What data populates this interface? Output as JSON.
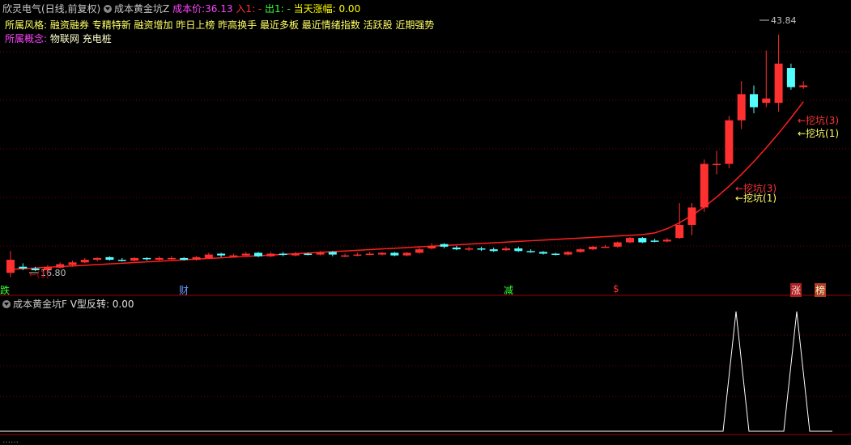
{
  "header": {
    "stock_name": "欣灵电气(日线,前复权)",
    "indicator_name": "成本黄金坑Z",
    "cost_label": "成本价:",
    "cost_value": "36.13",
    "in_label": "入1: -",
    "out_label": "出1: -",
    "change_label": "当天涨幅: 0.00"
  },
  "style": {
    "label": "所属风格:",
    "value": "融资融券 专精特新 融资增加 昨日上榜 昨高换手 最近多板 最近情绪指数 活跃股 近期强势"
  },
  "concept": {
    "label": "所属概念:",
    "value": "物联网 充电桩"
  },
  "price_labels": {
    "high": "43.84",
    "low": "16.80"
  },
  "annotations": {
    "dig3": "←挖坑(3)",
    "dig1": "←挖坑(1)",
    "low_overlay": "←(1)"
  },
  "bottom_markers": [
    "跌",
    "财",
    "减",
    "$",
    "涨",
    "榜"
  ],
  "sub_panel": {
    "title": "成本黄金坑F",
    "v_label": "V型反转: 0.00"
  },
  "footer": {
    "text": "……"
  },
  "colors": {
    "up": "#ff3030",
    "down": "#54ffff",
    "cost_line": "#ff1f1f",
    "grid": "#7a0000",
    "bg": "#000000"
  },
  "chart_data": {
    "type": "candlestick",
    "price_max_label": 43.84,
    "price_min_label": 16.8,
    "candles": [
      [
        16.5,
        18.0,
        19.0,
        16.0
      ],
      [
        17.2,
        17.0,
        17.6,
        16.8
      ],
      [
        17.0,
        16.8,
        17.2,
        16.7
      ],
      [
        16.8,
        17.2,
        17.4,
        16.6
      ],
      [
        17.1,
        17.5,
        17.7,
        17.0
      ],
      [
        17.4,
        17.7,
        17.9,
        17.2
      ],
      [
        17.7,
        18.0,
        18.2,
        17.6
      ],
      [
        18.0,
        18.2,
        18.3,
        17.8
      ],
      [
        18.3,
        18.0,
        18.4,
        17.9
      ],
      [
        18.0,
        17.9,
        18.2,
        17.8
      ],
      [
        17.9,
        18.2,
        18.3,
        17.8
      ],
      [
        18.2,
        18.1,
        18.3,
        17.9
      ],
      [
        18.0,
        18.2,
        18.4,
        17.9
      ],
      [
        18.1,
        18.2,
        18.4,
        18.0
      ],
      [
        18.2,
        18.0,
        18.3,
        17.9
      ],
      [
        18.0,
        18.3,
        18.4,
        17.9
      ],
      [
        18.2,
        18.6,
        18.8,
        18.1
      ],
      [
        18.7,
        18.5,
        18.8,
        18.3
      ],
      [
        18.5,
        18.5,
        18.7,
        18.3
      ],
      [
        18.5,
        18.7,
        18.9,
        18.4
      ],
      [
        18.8,
        18.4,
        18.9,
        18.3
      ],
      [
        18.4,
        18.7,
        18.9,
        18.3
      ],
      [
        18.7,
        18.6,
        18.9,
        18.4
      ],
      [
        18.5,
        18.7,
        18.9,
        18.4
      ],
      [
        18.7,
        18.6,
        18.8,
        18.5
      ],
      [
        18.6,
        18.8,
        19.0,
        18.5
      ],
      [
        18.9,
        18.6,
        19.0,
        18.4
      ],
      [
        18.5,
        18.5,
        18.7,
        18.3
      ],
      [
        18.6,
        18.6,
        18.8,
        18.4
      ],
      [
        18.6,
        18.7,
        18.9,
        18.5
      ],
      [
        18.6,
        18.8,
        18.9,
        18.5
      ],
      [
        18.8,
        18.5,
        18.9,
        18.4
      ],
      [
        18.5,
        18.8,
        18.9,
        18.4
      ],
      [
        18.8,
        19.2,
        19.4,
        18.7
      ],
      [
        19.3,
        19.6,
        19.9,
        19.2
      ],
      [
        19.8,
        19.5,
        19.9,
        19.3
      ],
      [
        19.4,
        19.2,
        19.6,
        19.1
      ],
      [
        19.2,
        19.3,
        19.5,
        19.0
      ],
      [
        19.3,
        19.2,
        19.5,
        19.0
      ],
      [
        19.2,
        19.0,
        19.4,
        18.9
      ],
      [
        19.1,
        19.3,
        19.5,
        19.0
      ],
      [
        19.3,
        19.0,
        19.5,
        18.9
      ],
      [
        19.0,
        18.9,
        19.2,
        18.8
      ],
      [
        18.9,
        18.7,
        19.0,
        18.6
      ],
      [
        18.7,
        18.6,
        18.8,
        18.5
      ],
      [
        18.6,
        18.9,
        19.0,
        18.5
      ],
      [
        18.9,
        19.2,
        19.3,
        18.8
      ],
      [
        19.2,
        19.5,
        19.6,
        19.1
      ],
      [
        19.5,
        19.5,
        19.7,
        19.4
      ],
      [
        19.5,
        20.0,
        20.1,
        19.4
      ],
      [
        20.0,
        20.5,
        20.6,
        19.9
      ],
      [
        20.5,
        20.0,
        20.6,
        19.9
      ],
      [
        20.2,
        20.1,
        20.4,
        20.0
      ],
      [
        20.1,
        20.3,
        20.5,
        20.0
      ],
      [
        20.5,
        22.0,
        24.5,
        20.4
      ],
      [
        22.0,
        24.0,
        24.5,
        20.8
      ],
      [
        24.0,
        29.0,
        29.5,
        23.5
      ],
      [
        29.0,
        29.0,
        30.5,
        27.8
      ],
      [
        29.0,
        34.0,
        34.5,
        28.5
      ],
      [
        34.0,
        37.0,
        38.5,
        33.0
      ],
      [
        37.0,
        35.5,
        38.0,
        34.8
      ],
      [
        36.0,
        36.5,
        42.0,
        35.5
      ],
      [
        36.0,
        40.5,
        43.84,
        35.0
      ],
      [
        40.0,
        37.8,
        40.5,
        37.5
      ],
      [
        37.8,
        38.0,
        38.5,
        37.6
      ]
    ],
    "cost_line_start": 16.9,
    "cost_line_end": 36.13
  }
}
